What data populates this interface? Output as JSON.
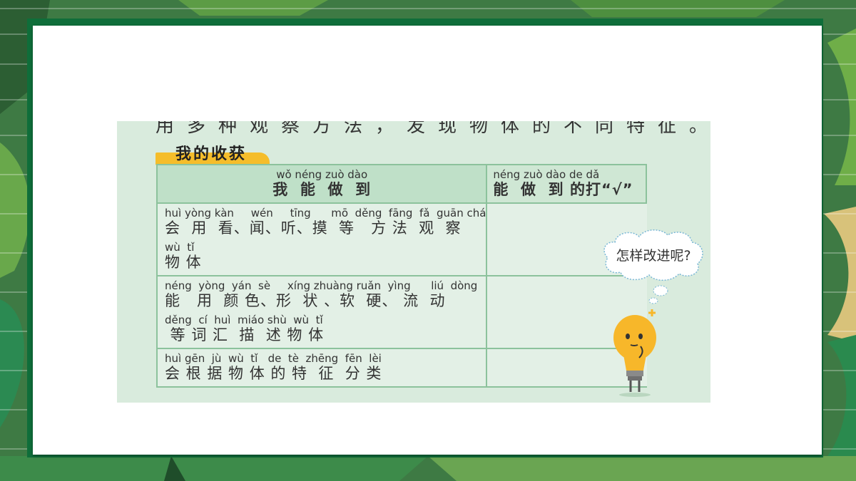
{
  "section_banner": "我的收获",
  "table": {
    "header": {
      "left": {
        "pinyin": "wǒ néng zuò dào",
        "hanzi": "我  能  做  到"
      },
      "right": {
        "pinyin": "néng zuò dào de dǎ",
        "hanzi": "能  做  到 的打“√”"
      }
    },
    "rows": [
      {
        "lines": [
          {
            "pinyin": "huì yòng kàn     wén     tīng      mō  děng  fāng  fǎ  guān chá",
            "hanzi": "会  用  看、闻、听、摸  等   方 法  观  察"
          },
          {
            "pinyin": "wù  tǐ",
            "hanzi": "物 体"
          }
        ]
      },
      {
        "lines": [
          {
            "pinyin": "néng  yòng  yán  sè     xíng zhuàng ruǎn  yìng      liú  dòng",
            "hanzi": "能   用  颜 色、形  状 、软  硬、 流  动"
          },
          {
            "pinyin": "děng  cí  huì  miáo shù  wù  tǐ",
            "hanzi": " 等 词 汇  描  述 物 体"
          }
        ]
      },
      {
        "lines": [
          {
            "pinyin": "huì gēn  jù  wù  tǐ   de  tè  zhēng  fēn  lèi",
            "hanzi": "会 根 据 物 体 的 特  征  分 类"
          }
        ]
      }
    ]
  },
  "thought_bubble": "怎样改进呢?",
  "colors": {
    "frame": "#0f6e3a",
    "image_bg": "#d9ebdd",
    "table_border": "#8cc29c",
    "header_bg": "#bfe0c8",
    "banner": "#f5bd2a",
    "bulb": "#f7b72a"
  }
}
